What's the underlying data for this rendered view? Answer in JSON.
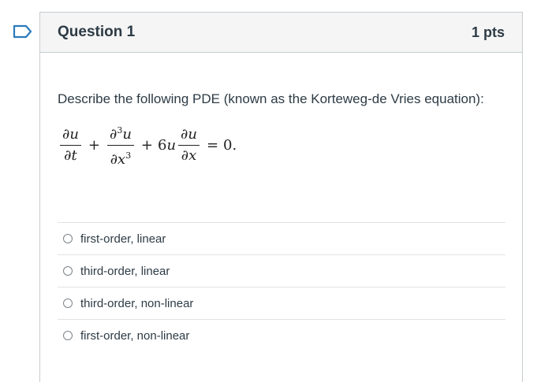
{
  "question": {
    "title": "Question 1",
    "points": "1 pts",
    "text": "Describe the following PDE (known as the Korteweg-de Vries equation):",
    "equation": {
      "term1_num": "∂u",
      "term1_den": "∂t",
      "op1": "+",
      "term2_num": "∂3u",
      "term2_den": "∂x3",
      "op2": "+ 6u",
      "term3_num": "∂u",
      "term3_den": "∂x",
      "rhs": "= 0."
    }
  },
  "answers": [
    {
      "label": "first-order, linear",
      "selected": false
    },
    {
      "label": "third-order, linear",
      "selected": false
    },
    {
      "label": "third-order, non-linear",
      "selected": false
    },
    {
      "label": "first-order, non-linear",
      "selected": false
    }
  ],
  "colors": {
    "flag": "#2b7abc",
    "header_bg": "#f5f5f5",
    "text": "#2d3b45",
    "border": "#c7cdd1"
  },
  "icons": {
    "flag": "bookmark-flag-icon",
    "radio": "radio-unchecked-icon"
  }
}
